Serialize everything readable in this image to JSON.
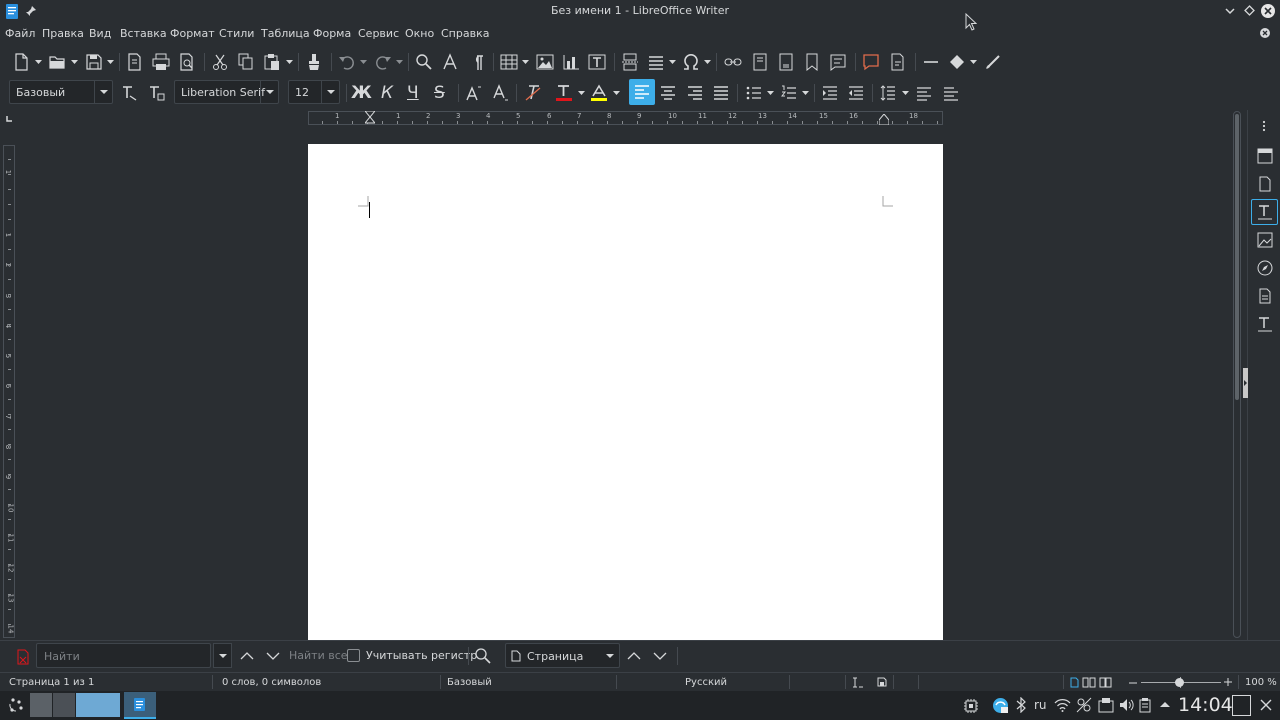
{
  "window": {
    "title": "Без имени 1 - LibreOffice Writer"
  },
  "menu": [
    "Файл",
    "Правка",
    "Вид",
    "Вставка",
    "Формат",
    "Стили",
    "Таблица",
    "Форма",
    "Сервис",
    "Окно",
    "Справка"
  ],
  "formatting": {
    "paragraph_style": "Базовый",
    "font_name": "Liberation Serif",
    "font_size": "12",
    "bold_label": "Ж",
    "italic_label": "К",
    "underline_label": "Ч",
    "strike_label": "S",
    "font_color": "#e0151b",
    "highlight_color": "#ffff00",
    "accent": "#3daee9"
  },
  "ruler": {
    "h_ticks": [
      "1",
      "1",
      "2",
      "3",
      "4",
      "5",
      "6",
      "7",
      "8",
      "9",
      "10",
      "11",
      "12",
      "13",
      "14",
      "15",
      "16",
      "18"
    ],
    "v_ticks": [
      "1",
      "1",
      "2",
      "3",
      "4",
      "5",
      "6",
      "7",
      "8",
      "9",
      "10",
      "11",
      "12",
      "13",
      "14"
    ]
  },
  "find": {
    "placeholder": "Найти",
    "find_all_label": "Найти все",
    "match_case_label": "Учитывать регистр",
    "search_mode": "Страница"
  },
  "status": {
    "page": "Страница 1 из 1",
    "words": "0 слов, 0 символов",
    "style": "Базовый",
    "language": "Русский",
    "zoom": "100 %",
    "zoom_level": 1.0
  },
  "taskbar": {
    "keyboard_layout": "ru",
    "clock": "14:04"
  }
}
